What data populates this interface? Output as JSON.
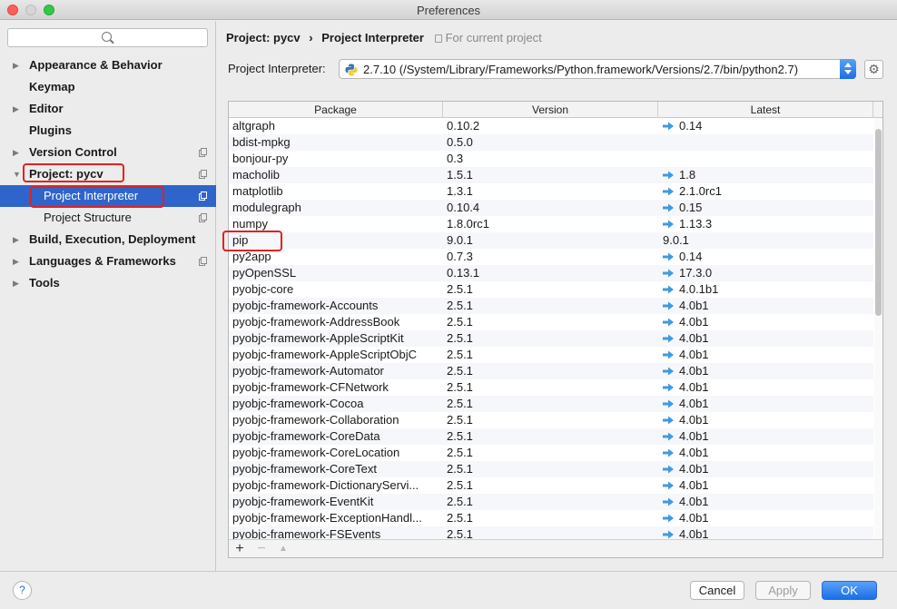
{
  "window": {
    "title": "Preferences"
  },
  "sidebar": {
    "items": [
      {
        "label": "Appearance & Behavior",
        "expandable": true
      },
      {
        "label": "Keymap",
        "expandable": false
      },
      {
        "label": "Editor",
        "expandable": true
      },
      {
        "label": "Plugins",
        "expandable": false
      },
      {
        "label": "Version Control",
        "expandable": true
      },
      {
        "label": "Project: pycv",
        "expandable": true,
        "expanded": true
      },
      {
        "label": "Project Interpreter",
        "sub": true,
        "selected": true
      },
      {
        "label": "Project Structure",
        "sub": true
      },
      {
        "label": "Build, Execution, Deployment",
        "expandable": true
      },
      {
        "label": "Languages & Frameworks",
        "expandable": true
      },
      {
        "label": "Tools",
        "expandable": true
      }
    ]
  },
  "breadcrumb": {
    "project": "Project: pycv",
    "separator": "›",
    "page": "Project Interpreter",
    "scope": "For current project"
  },
  "interpreter": {
    "label": "Project Interpreter:",
    "value": "2.7.10 (/System/Library/Frameworks/Python.framework/Versions/2.7/bin/python2.7)"
  },
  "packages": {
    "columns": [
      "Package",
      "Version",
      "Latest"
    ],
    "rows": [
      {
        "package": "altgraph",
        "version": "0.10.2",
        "latest": "0.14",
        "upgrade": true
      },
      {
        "package": "bdist-mpkg",
        "version": "0.5.0",
        "latest": "",
        "upgrade": false
      },
      {
        "package": "bonjour-py",
        "version": "0.3",
        "latest": "",
        "upgrade": false
      },
      {
        "package": "macholib",
        "version": "1.5.1",
        "latest": "1.8",
        "upgrade": true
      },
      {
        "package": "matplotlib",
        "version": "1.3.1",
        "latest": "2.1.0rc1",
        "upgrade": true
      },
      {
        "package": "modulegraph",
        "version": "0.10.4",
        "latest": "0.15",
        "upgrade": true
      },
      {
        "package": "numpy",
        "version": "1.8.0rc1",
        "latest": "1.13.3",
        "upgrade": true
      },
      {
        "package": "pip",
        "version": "9.0.1",
        "latest": "9.0.1",
        "upgrade": false
      },
      {
        "package": "py2app",
        "version": "0.7.3",
        "latest": "0.14",
        "upgrade": true
      },
      {
        "package": "pyOpenSSL",
        "version": "0.13.1",
        "latest": "17.3.0",
        "upgrade": true
      },
      {
        "package": "pyobjc-core",
        "version": "2.5.1",
        "latest": "4.0.1b1",
        "upgrade": true
      },
      {
        "package": "pyobjc-framework-Accounts",
        "version": "2.5.1",
        "latest": "4.0b1",
        "upgrade": true
      },
      {
        "package": "pyobjc-framework-AddressBook",
        "version": "2.5.1",
        "latest": "4.0b1",
        "upgrade": true
      },
      {
        "package": "pyobjc-framework-AppleScriptKit",
        "version": "2.5.1",
        "latest": "4.0b1",
        "upgrade": true
      },
      {
        "package": "pyobjc-framework-AppleScriptObjC",
        "version": "2.5.1",
        "latest": "4.0b1",
        "upgrade": true
      },
      {
        "package": "pyobjc-framework-Automator",
        "version": "2.5.1",
        "latest": "4.0b1",
        "upgrade": true
      },
      {
        "package": "pyobjc-framework-CFNetwork",
        "version": "2.5.1",
        "latest": "4.0b1",
        "upgrade": true
      },
      {
        "package": "pyobjc-framework-Cocoa",
        "version": "2.5.1",
        "latest": "4.0b1",
        "upgrade": true
      },
      {
        "package": "pyobjc-framework-Collaboration",
        "version": "2.5.1",
        "latest": "4.0b1",
        "upgrade": true
      },
      {
        "package": "pyobjc-framework-CoreData",
        "version": "2.5.1",
        "latest": "4.0b1",
        "upgrade": true
      },
      {
        "package": "pyobjc-framework-CoreLocation",
        "version": "2.5.1",
        "latest": "4.0b1",
        "upgrade": true
      },
      {
        "package": "pyobjc-framework-CoreText",
        "version": "2.5.1",
        "latest": "4.0b1",
        "upgrade": true
      },
      {
        "package": "pyobjc-framework-DictionaryServi...",
        "version": "2.5.1",
        "latest": "4.0b1",
        "upgrade": true
      },
      {
        "package": "pyobjc-framework-EventKit",
        "version": "2.5.1",
        "latest": "4.0b1",
        "upgrade": true
      },
      {
        "package": "pyobjc-framework-ExceptionHandl...",
        "version": "2.5.1",
        "latest": "4.0b1",
        "upgrade": true
      },
      {
        "package": "pyobjc-framework-FSEvents",
        "version": "2.5.1",
        "latest": "4.0b1",
        "upgrade": true
      }
    ]
  },
  "table_footer": {
    "add": "+",
    "remove": "−",
    "upgrade": "▲"
  },
  "footer": {
    "help": "?",
    "cancel": "Cancel",
    "apply": "Apply",
    "ok": "OK"
  },
  "colors": {
    "accent": "#2f65ca",
    "highlight": "#e3211f",
    "upgrade_arrow": "#3d9be0"
  }
}
